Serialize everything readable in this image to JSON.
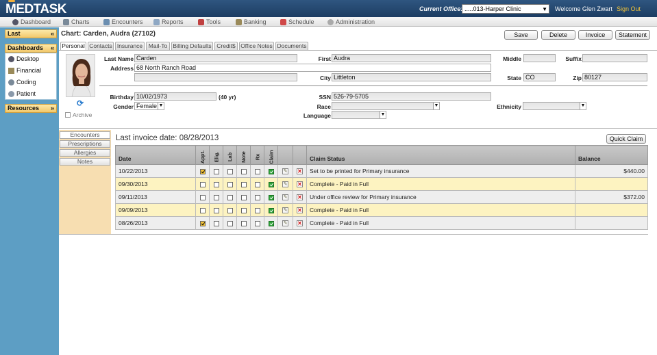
{
  "app": {
    "logo": "MEDTASK"
  },
  "header": {
    "office_label": "Current Office:",
    "office_value": ".....013-Harper Clinic",
    "welcome": "Welcome Glen Zwart",
    "signout": "Sign Out"
  },
  "menu": [
    "Dashboard",
    "Charts",
    "Encounters",
    "Reports",
    "Tools",
    "Banking",
    "Schedule",
    "Administration"
  ],
  "sidebar": {
    "last": "Last",
    "dashboards": "Dashboards",
    "dashboard_items": [
      "Desktop",
      "Financial",
      "Coding",
      "Patient"
    ],
    "resources": "Resources"
  },
  "chart": {
    "title": "Chart: Carden, Audra (27102)"
  },
  "buttons": {
    "save": "Save",
    "delete": "Delete",
    "invoice": "Invoice",
    "statement": "Statement",
    "quick_claim": "Quick Claim"
  },
  "tabs": [
    "Personal",
    "Contacts",
    "Insurance",
    "Mail-To",
    "Billing Defaults",
    "Credit$",
    "Office Notes",
    "Documents"
  ],
  "patient": {
    "last_name_label": "Last Name",
    "last_name": "Carden",
    "first_label": "First",
    "first": "Audra",
    "middle_label": "Middle",
    "middle": "",
    "suffix_label": "Suffix",
    "suffix": "",
    "address_label": "Address",
    "address1": "68 North Ranch Road",
    "address2": "",
    "city_label": "City",
    "city": "Littleton",
    "state_label": "State",
    "state": "CO",
    "zip_label": "Zip",
    "zip": "80127",
    "birthday_label": "Birthday",
    "birthday": "10/02/1973",
    "age": "(40 yr)",
    "ssn_label": "SSN",
    "ssn": "526-79-5705",
    "gender_label": "Gender",
    "gender": "Female",
    "race_label": "Race",
    "race": "",
    "ethnicity_label": "Ethnicity",
    "ethnicity": "",
    "language_label": "Language",
    "language": "",
    "archive_label": "Archive"
  },
  "side_tabs": [
    "Encounters",
    "Prescriptions",
    "Allergies",
    "Notes"
  ],
  "invoice": {
    "last_invoice": "Last invoice date: 08/28/2013"
  },
  "grid": {
    "headers": {
      "date": "Date",
      "appt": "Appt.",
      "elig": "Elig.",
      "lab": "Lab",
      "note": "Note",
      "rx": "Rx",
      "claim": "Claim",
      "status": "Claim Status",
      "balance": "Balance"
    },
    "rows": [
      {
        "date": "10/22/2013",
        "appt": true,
        "claim": true,
        "status": "Set to be printed for Primary insurance",
        "balance": "$440.00"
      },
      {
        "date": "09/30/2013",
        "appt": false,
        "claim": true,
        "status": "Complete - Paid in Full",
        "balance": ""
      },
      {
        "date": "09/11/2013",
        "appt": false,
        "claim": true,
        "status": "Under office review for Primary insurance",
        "balance": "$372.00"
      },
      {
        "date": "09/09/2013",
        "appt": false,
        "claim": true,
        "status": "Complete - Paid in Full",
        "balance": ""
      },
      {
        "date": "08/26/2013",
        "appt": true,
        "claim": true,
        "status": "Complete - Paid in Full",
        "balance": ""
      }
    ]
  },
  "colors": {
    "topbar": "#1c3c62",
    "sidebar": "#5d9ec4",
    "accent": "#f3c53a",
    "row_alt": "#fdf3c1"
  }
}
